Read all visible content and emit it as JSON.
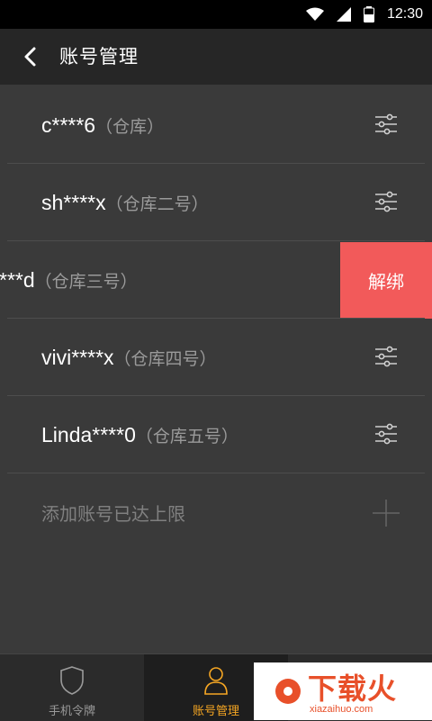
{
  "status_bar": {
    "time": "12:30"
  },
  "header": {
    "title": "账号管理"
  },
  "accounts": [
    {
      "name": "c****6",
      "tag": "（仓库）"
    },
    {
      "name": "sh****x",
      "tag": "（仓库二号）"
    },
    {
      "name": "***d",
      "tag": "（仓库三号）",
      "action": "解绑"
    },
    {
      "name": "vivi****x",
      "tag": "（仓库四号）"
    },
    {
      "name": "Linda****0",
      "tag": "（仓库五号）"
    }
  ],
  "add_account": {
    "label": "添加账号已达上限"
  },
  "tabs": [
    {
      "label": "手机令牌"
    },
    {
      "label": "账号管理"
    }
  ],
  "ad": {
    "brand": "下载火",
    "url": "xiazaihuo.com"
  },
  "colors": {
    "accent": "#f5a623",
    "unbind": "#f25a5a",
    "ad": "#e8502a"
  }
}
